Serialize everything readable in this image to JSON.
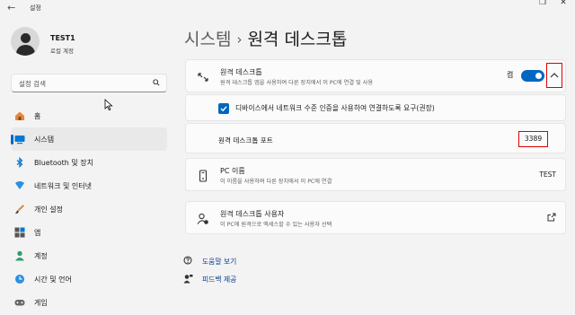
{
  "window": {
    "title": "설정"
  },
  "profile": {
    "name": "TEST1",
    "account_type": "로컬 계정"
  },
  "search": {
    "placeholder": "설정 검색"
  },
  "sidebar": {
    "items": [
      {
        "label": "홈",
        "icon": "home-icon"
      },
      {
        "label": "시스템",
        "icon": "system-icon",
        "selected": true
      },
      {
        "label": "Bluetooth 및 장치",
        "icon": "bluetooth-icon"
      },
      {
        "label": "네트워크 및 인터넷",
        "icon": "network-icon"
      },
      {
        "label": "개인 설정",
        "icon": "brush-icon"
      },
      {
        "label": "앱",
        "icon": "apps-icon"
      },
      {
        "label": "계정",
        "icon": "account-icon"
      },
      {
        "label": "시간 및 언어",
        "icon": "globe-clock-icon"
      },
      {
        "label": "게임",
        "icon": "controller-icon"
      }
    ]
  },
  "breadcrumb": {
    "parent": "시스템",
    "separator": "›",
    "current": "원격 데스크톱"
  },
  "remote_desktop": {
    "title": "원격 데스크톱",
    "description": "원격 데스크톱 앱을 사용하여 다른 장치에서 이 PC에 연결 및 사용",
    "toggle_label": "켬",
    "enabled": true,
    "nla_label": "디바이스에서 네트워크 수준 인증을 사용하여 연결하도록 요구(권장)",
    "nla_checked": true,
    "port_label": "원격 데스크톱 포트",
    "port_value": "3389"
  },
  "pc_name": {
    "title": "PC 이름",
    "description": "이 이름을 사용하여 다른 장치에서 이 PC에 연결",
    "value": "TEST"
  },
  "remote_users": {
    "title": "원격 데스크톱 사용자",
    "description": "이 PC에 원격으로 액세스할 수 있는 사용자 선택"
  },
  "links": {
    "help": "도움말 보기",
    "feedback": "피드백 제공"
  },
  "colors": {
    "accent": "#0067c0",
    "highlight": "#dd0000",
    "background": "#f3f3f3"
  }
}
